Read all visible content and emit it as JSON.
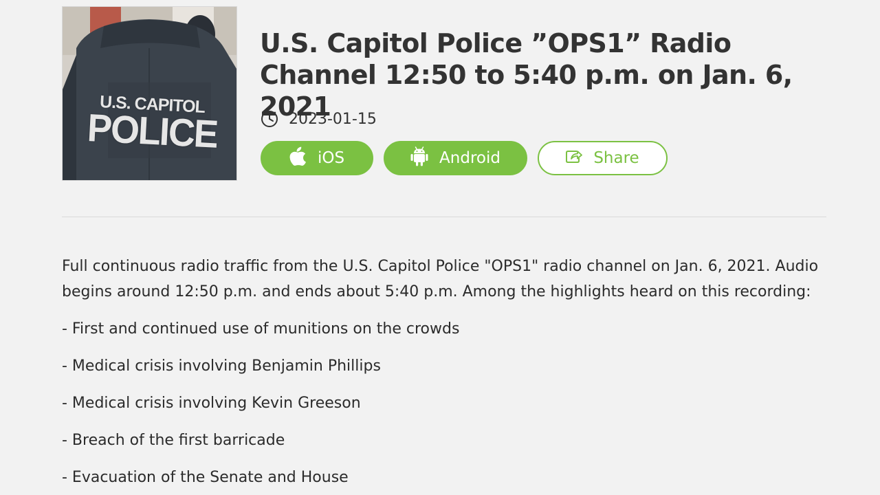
{
  "episode": {
    "cover_text_line1": "U.S. CAPITOL",
    "cover_text_line2": "POLICE",
    "title": "U.S. Capitol Police ”OPS1” Radio Channel 12:50 to 5:40 p.m. on Jan. 6, 2021",
    "date": "2023-01-15",
    "date_icon": "clock-icon"
  },
  "actions": {
    "ios_label": "iOS",
    "ios_icon": "apple-icon",
    "android_label": "Android",
    "android_icon": "android-icon",
    "share_label": "Share",
    "share_icon": "share-icon"
  },
  "description": {
    "intro": "Full continuous radio traffic from the U.S. Capitol Police \"OPS1\" radio channel on Jan. 6, 2021. Audio begins around 12:50 p.m. and ends about 5:40 p.m. Among the highlights heard on this recording:",
    "highlights": [
      "- First and continued use of munitions on the crowds",
      "- Medical crisis involving Benjamin Phillips",
      "- Medical crisis involving Kevin Greeson",
      "- Breach of the first barricade",
      "- Evacuation of the Senate and House"
    ]
  },
  "colors": {
    "accent": "#7bc142",
    "background": "#f2f2f2",
    "text": "#333333"
  }
}
